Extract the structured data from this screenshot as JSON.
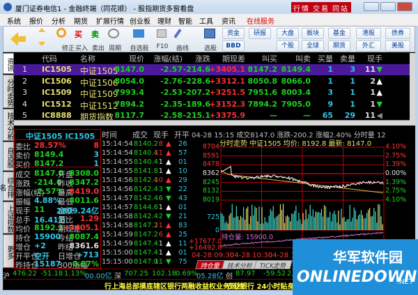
{
  "window": {
    "title": "厦门证券电信1 - 金融终端（同花顺） - 股指期货多窗看盘",
    "buttons": [
      "行情",
      "交易",
      "同站"
    ]
  },
  "menu": [
    "系统",
    "报价",
    "分析",
    "期货",
    "扩展行情",
    "创业板",
    "理财",
    "智能",
    "工具",
    "资讯",
    "在线服务"
  ],
  "toolbar": {
    "labels": [
      "修正",
      "买入",
      "卖出",
      "周期",
      "自选股",
      "F10",
      "画线",
      "选股"
    ],
    "buy": "买",
    "sell": "卖",
    "dropdowns": [
      "资金",
      "研报",
      "大盘",
      "板块",
      "基金",
      "港股",
      "债券",
      "个股",
      "全球",
      "期货",
      "外汇",
      "美股"
    ],
    "bbd": "BBD"
  },
  "sidebar": [
    "资讯",
    "分时走势",
    "技术分析",
    "自选股",
    "综合排名",
    "上证指数",
    "更多"
  ],
  "table": {
    "headers": [
      "代码",
      "名称",
      "现价",
      "涨幅(结)",
      "涨跌",
      "期现差",
      "叫买",
      "叫卖",
      "买量",
      "卖量",
      "现手"
    ],
    "rows": [
      [
        "1",
        "IC1505",
        "中证1505",
        "8147.0",
        "-2.57",
        "-214.6",
        "+3405.1",
        "8147.2",
        "8149.4",
        "1",
        "3",
        "11",
        "down"
      ],
      [
        "2",
        "IC1506",
        "中证1506",
        "8054.0",
        "-2.76",
        "-228.6",
        "+3312.1",
        "8050.8",
        "8066.0",
        "1",
        "1",
        "2",
        "up"
      ],
      [
        "3",
        "IC1509",
        "中证1509",
        "7993.4",
        "-2.53",
        "-207.2",
        "+3251.5",
        "7951.6",
        "8003.4",
        "3",
        "1",
        "1",
        "up"
      ],
      [
        "4",
        "IC1512",
        "中证1512",
        "7894.2",
        "-2.35",
        "-189.6",
        "+3152.3",
        "7894.2",
        "7905.0",
        "9",
        "1",
        "1",
        "down"
      ],
      [
        "5",
        "IC8888",
        "期货指数",
        "8117.7",
        "-2.58",
        "-215.1",
        "+3375.9",
        "—",
        "—",
        "65",
        "29",
        "11",
        "flat"
      ]
    ]
  },
  "quote": {
    "title": "中证1505 IC1505",
    "top": [
      [
        "委比",
        "28.57%",
        "8"
      ],
      [
        "卖价",
        "8149.4",
        "3"
      ],
      [
        "买价",
        "8147.2",
        "1"
      ]
    ],
    "rows": [
      [
        "成交",
        "8147.0",
        "开盘",
        "8308.0"
      ],
      [
        "涨跌",
        "-214.6",
        "昨收",
        "8347.2"
      ],
      [
        "涨幅(结)",
        "-2.57%",
        "最高",
        "8419.0"
      ],
      [
        "振幅",
        "4.88%",
        "最低",
        "8011.6"
      ],
      [
        "现手",
        "11",
        "金额",
        "2809.24亿"
      ],
      [
        "总手",
        "16.41万",
        "量比",
        "1.29"
      ],
      [
        "均价",
        "8192.1",
        "期现差",
        "+3405.1"
      ],
      [
        "持仓",
        "15900",
        "今结",
        "8087.4"
      ],
      [
        "增仓",
        "+2",
        "昨结",
        "8361.6"
      ],
      [
        "开平仓",
        "空开",
        "日增仓",
        "+713"
      ],
      [
        "昨持仓",
        "15187",
        "300涨幅",
        "-0.87%"
      ]
    ]
  },
  "ticks": {
    "headers": [
      "时间",
      "成交",
      "现手",
      "开平"
    ],
    "rows": [
      [
        "15:14:54",
        "8140.2",
        "8",
        "up",
        "26"
      ],
      [
        "15:14:54",
        "8140.4",
        "11",
        "up",
        "57"
      ],
      [
        "15:14:55",
        "8140.4",
        "1",
        "up",
        "01"
      ],
      [
        "15:14:55",
        "8141.8",
        "1",
        "up",
        "10"
      ],
      [
        "15:14:56",
        "8142.4",
        "10",
        "up",
        "29"
      ],
      [
        "15:14:56",
        "8142.4",
        "3",
        "down",
        "22"
      ],
      [
        "15:14:57",
        "8142.4",
        "6",
        "down",
        "43"
      ],
      [
        "15:14:57",
        "8144.6",
        "1",
        "up",
        "01"
      ],
      [
        "15:14:58",
        "8142.4",
        "2",
        "down",
        "21"
      ],
      [
        "15:14:58",
        "8147.2",
        "11",
        "up",
        "83"
      ],
      [
        "15:14:59",
        "8147.2",
        "6",
        "up",
        "25"
      ],
      [
        "15:14:59",
        "8147.4",
        "1",
        "up",
        "11"
      ],
      [
        "15:15:00",
        "8147.4",
        "1",
        "up",
        "01"
      ],
      [
        "15:15:00",
        "8147.0",
        "11",
        "down",
        "75"
      ]
    ]
  },
  "chart": {
    "info": "04-28 15:15 成交8147.0 涨跌-200.2 涨幅2.40% 分时量 12",
    "subtitle": "分时走势 中证1505 均价: 8192.8 最新: 8147.0",
    "price_ticks": [
      "8704",
      "8591",
      "8478",
      "8362",
      "8245",
      "8132",
      "8019"
    ],
    "pct_ticks": [
      "4.10%",
      "2.75%",
      "1.39%",
      "0.00%",
      "1.39%",
      "2.75%",
      "4.10%"
    ],
    "vol_ticks": [
      "725",
      "0"
    ],
    "oi_label": "持仓量: 15900.0",
    "oi_ticks": [
      "+17677.0",
      "+16492.8"
    ],
    "time_labels": [
      "04-28 09:30",
      "04-28 10:30",
      "04-28 11"
    ],
    "tabs": [
      "持仓量",
      "技术分析",
      "TICK走势"
    ]
  },
  "bottom": {
    "sh": [
      "沪",
      "476.22",
      "-51.18",
      "1.13%",
      "00.00亿"
    ],
    "sz": [
      "深",
      "707.25",
      "102.18",
      "0.69%",
      "05.28亿"
    ],
    "cy": [
      "创",
      "87.97",
      "-59.52",
      "2.17%",
      "6.12"
    ]
  },
  "ticker": [
    "行上海总部摸底辖区银行两融收益权业务风险",
    "农业银行 24小时贴身的"
  ],
  "watermark": {
    "cn": "华军软件园",
    "en": "ONLINEDOWN",
    "net": ".NET"
  },
  "colors": {
    "up": "#ff3030",
    "down": "#20d020",
    "selected_row": "#4a1a9a",
    "background": "#000000"
  }
}
